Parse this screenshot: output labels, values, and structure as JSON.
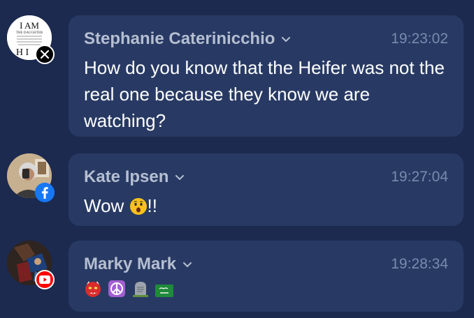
{
  "messages": [
    {
      "author": "Stephanie Caterinicchio",
      "time": "19:23:02",
      "text": "How do you know that the Heifer was not the real one because they know we are watching?",
      "platform": "x-icon",
      "avatar_lines": [
        "I AM",
        "THE DAUGHTER",
        "H I"
      ]
    },
    {
      "author": "Kate Ipsen",
      "time": "19:27:04",
      "text_before": "Wow ",
      "emoji": "hushed-face-emoji",
      "text_after": "!!",
      "platform": "facebook-icon"
    },
    {
      "author": "Marky Mark",
      "time": "19:28:34",
      "emojis": [
        "ogre-emoji",
        "peace-symbol-emoji",
        "headstone-emoji",
        "saudi-flag-emoji"
      ],
      "platform": "youtube-icon"
    }
  ],
  "colors": {
    "background": "#1c2a4f",
    "bubble": "#283a64",
    "author": "#b6bfd1",
    "time": "#7a8aae",
    "text": "#ffffff",
    "facebook": "#1877f2",
    "youtube": "#ff0000"
  }
}
